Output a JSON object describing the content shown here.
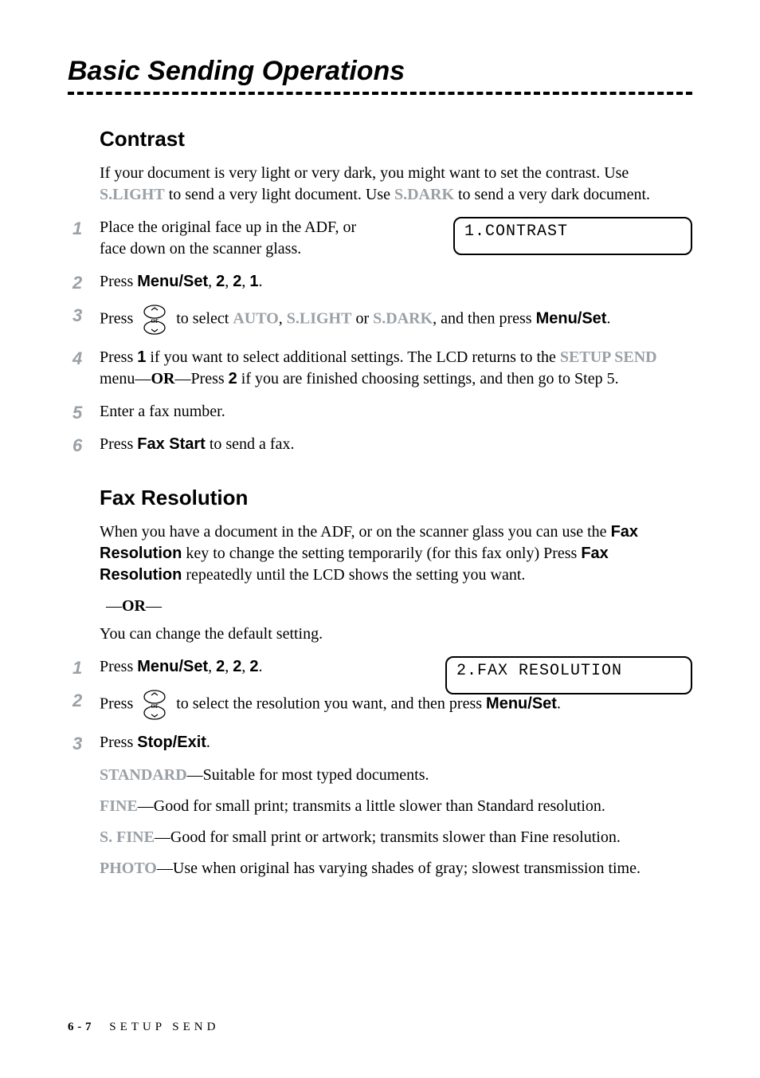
{
  "section_title": "Basic Sending Operations",
  "contrast": {
    "heading": "Contrast",
    "intro_1": "If your document is very light or very dark, you might want to set the contrast. Use ",
    "intro_kw1": "S.LIGHT",
    "intro_2": " to send a very light document. Use ",
    "intro_kw2": "S.DARK",
    "intro_3": " to send a very dark document.",
    "lcd": "1.CONTRAST",
    "steps": {
      "s1": "Place the original face up in the ADF, or face down on the scanner glass.",
      "s2_a": "Press ",
      "s2_menu": "Menu/Set",
      "s2_b": ", ",
      "s2_k1": "2",
      "s2_c": ", ",
      "s2_k2": "2",
      "s2_d": ", ",
      "s2_k3": "1",
      "s2_e": ".",
      "s3_a": "Press ",
      "s3_b": " to select ",
      "s3_kw1": "AUTO",
      "s3_c": ", ",
      "s3_kw2": "S.LIGHT",
      "s3_d": " or ",
      "s3_kw3": "S.DARK",
      "s3_e": ", and then press ",
      "s3_menu": "Menu/Set",
      "s3_f": ".",
      "s4_a": "Press ",
      "s4_k1": "1",
      "s4_b": " if you want to select additional settings. The LCD returns to the ",
      "s4_kw1": "SETUP SEND",
      "s4_c": " menu—",
      "s4_or": "OR",
      "s4_d": "—Press ",
      "s4_k2": "2",
      "s4_e": " if you are finished choosing settings, and then go to Step 5.",
      "s5": "Enter a fax number.",
      "s6_a": "Press ",
      "s6_fax": "Fax Start",
      "s6_b": " to send a fax."
    }
  },
  "faxres": {
    "heading": "Fax Resolution",
    "intro_a": "When you have a document in the ADF, or on the scanner glass you can use the ",
    "intro_kw1": "Fax Resolution",
    "intro_b": " key to change the setting temporarily (for this fax only) Press ",
    "intro_kw2": "Fax Resolution",
    "intro_c": " repeatedly until the LCD shows the setting you want.",
    "or_a": " —",
    "or_b": "OR",
    "or_c": "—",
    "intro2": "You can change the default setting.",
    "lcd": "2.FAX RESOLUTION",
    "steps": {
      "s1_a": "Press ",
      "s1_menu": "Menu/Set",
      "s1_b": ", ",
      "s1_k1": "2",
      "s1_c": ", ",
      "s1_k2": "2",
      "s1_d": ", ",
      "s1_k3": "2",
      "s1_e": ".",
      "s2_a": "Press ",
      "s2_b": " to select the resolution you want, and then press ",
      "s2_menu": "Menu/Set",
      "s2_c": ".",
      "s3_a": "Press ",
      "s3_stop": "Stop/Exit",
      "s3_b": "."
    },
    "defs": {
      "d1_kw": "STANDARD",
      "d1_t": "—Suitable for most typed documents.",
      "d2_kw": "FINE",
      "d2_t": "—Good for small print; transmits a little slower than Standard resolution.",
      "d3_kw": "S. FINE",
      "d3_t": "—Good for small print or artwork; transmits slower than Fine resolution.",
      "d4_kw": "PHOTO",
      "d4_t": "—Use when original has varying shades of gray; slowest transmission time."
    }
  },
  "footer": {
    "page": "6 - 7",
    "chapter": "SETUP SEND"
  },
  "nums": {
    "n1": "1",
    "n2": "2",
    "n3": "3",
    "n4": "4",
    "n5": "5",
    "n6": "6"
  }
}
